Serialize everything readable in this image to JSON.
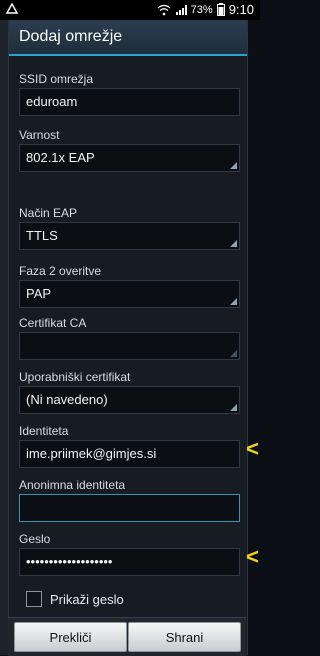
{
  "status_bar": {
    "battery_percent": "73%",
    "time": "9:10"
  },
  "dialog": {
    "title": "Dodaj omrežje"
  },
  "fields": {
    "ssid_label": "SSID omrežja",
    "ssid_value": "eduroam",
    "security_label": "Varnost",
    "security_value": "802.1x EAP",
    "eap_method_label": "Način EAP",
    "eap_method_value": "TTLS",
    "phase2_label": "Faza 2 overitve",
    "phase2_value": "PAP",
    "ca_cert_label": "Certifikat CA",
    "ca_cert_value": "",
    "user_cert_label": "Uporabniški certifikat",
    "user_cert_value": "(Ni navedeno)",
    "identity_label": "Identiteta",
    "identity_value": "ime.priimek@gimjes.si",
    "anon_identity_label": "Anonimna identiteta",
    "anon_identity_value": "",
    "password_label": "Geslo",
    "password_value": "•••••••••••••••••••"
  },
  "show_password_label": "Prikaži geslo",
  "buttons": {
    "cancel": "Prekliči",
    "save": "Shrani"
  },
  "colors": {
    "accent": "#30a2cf",
    "marker": "#f1d419"
  }
}
